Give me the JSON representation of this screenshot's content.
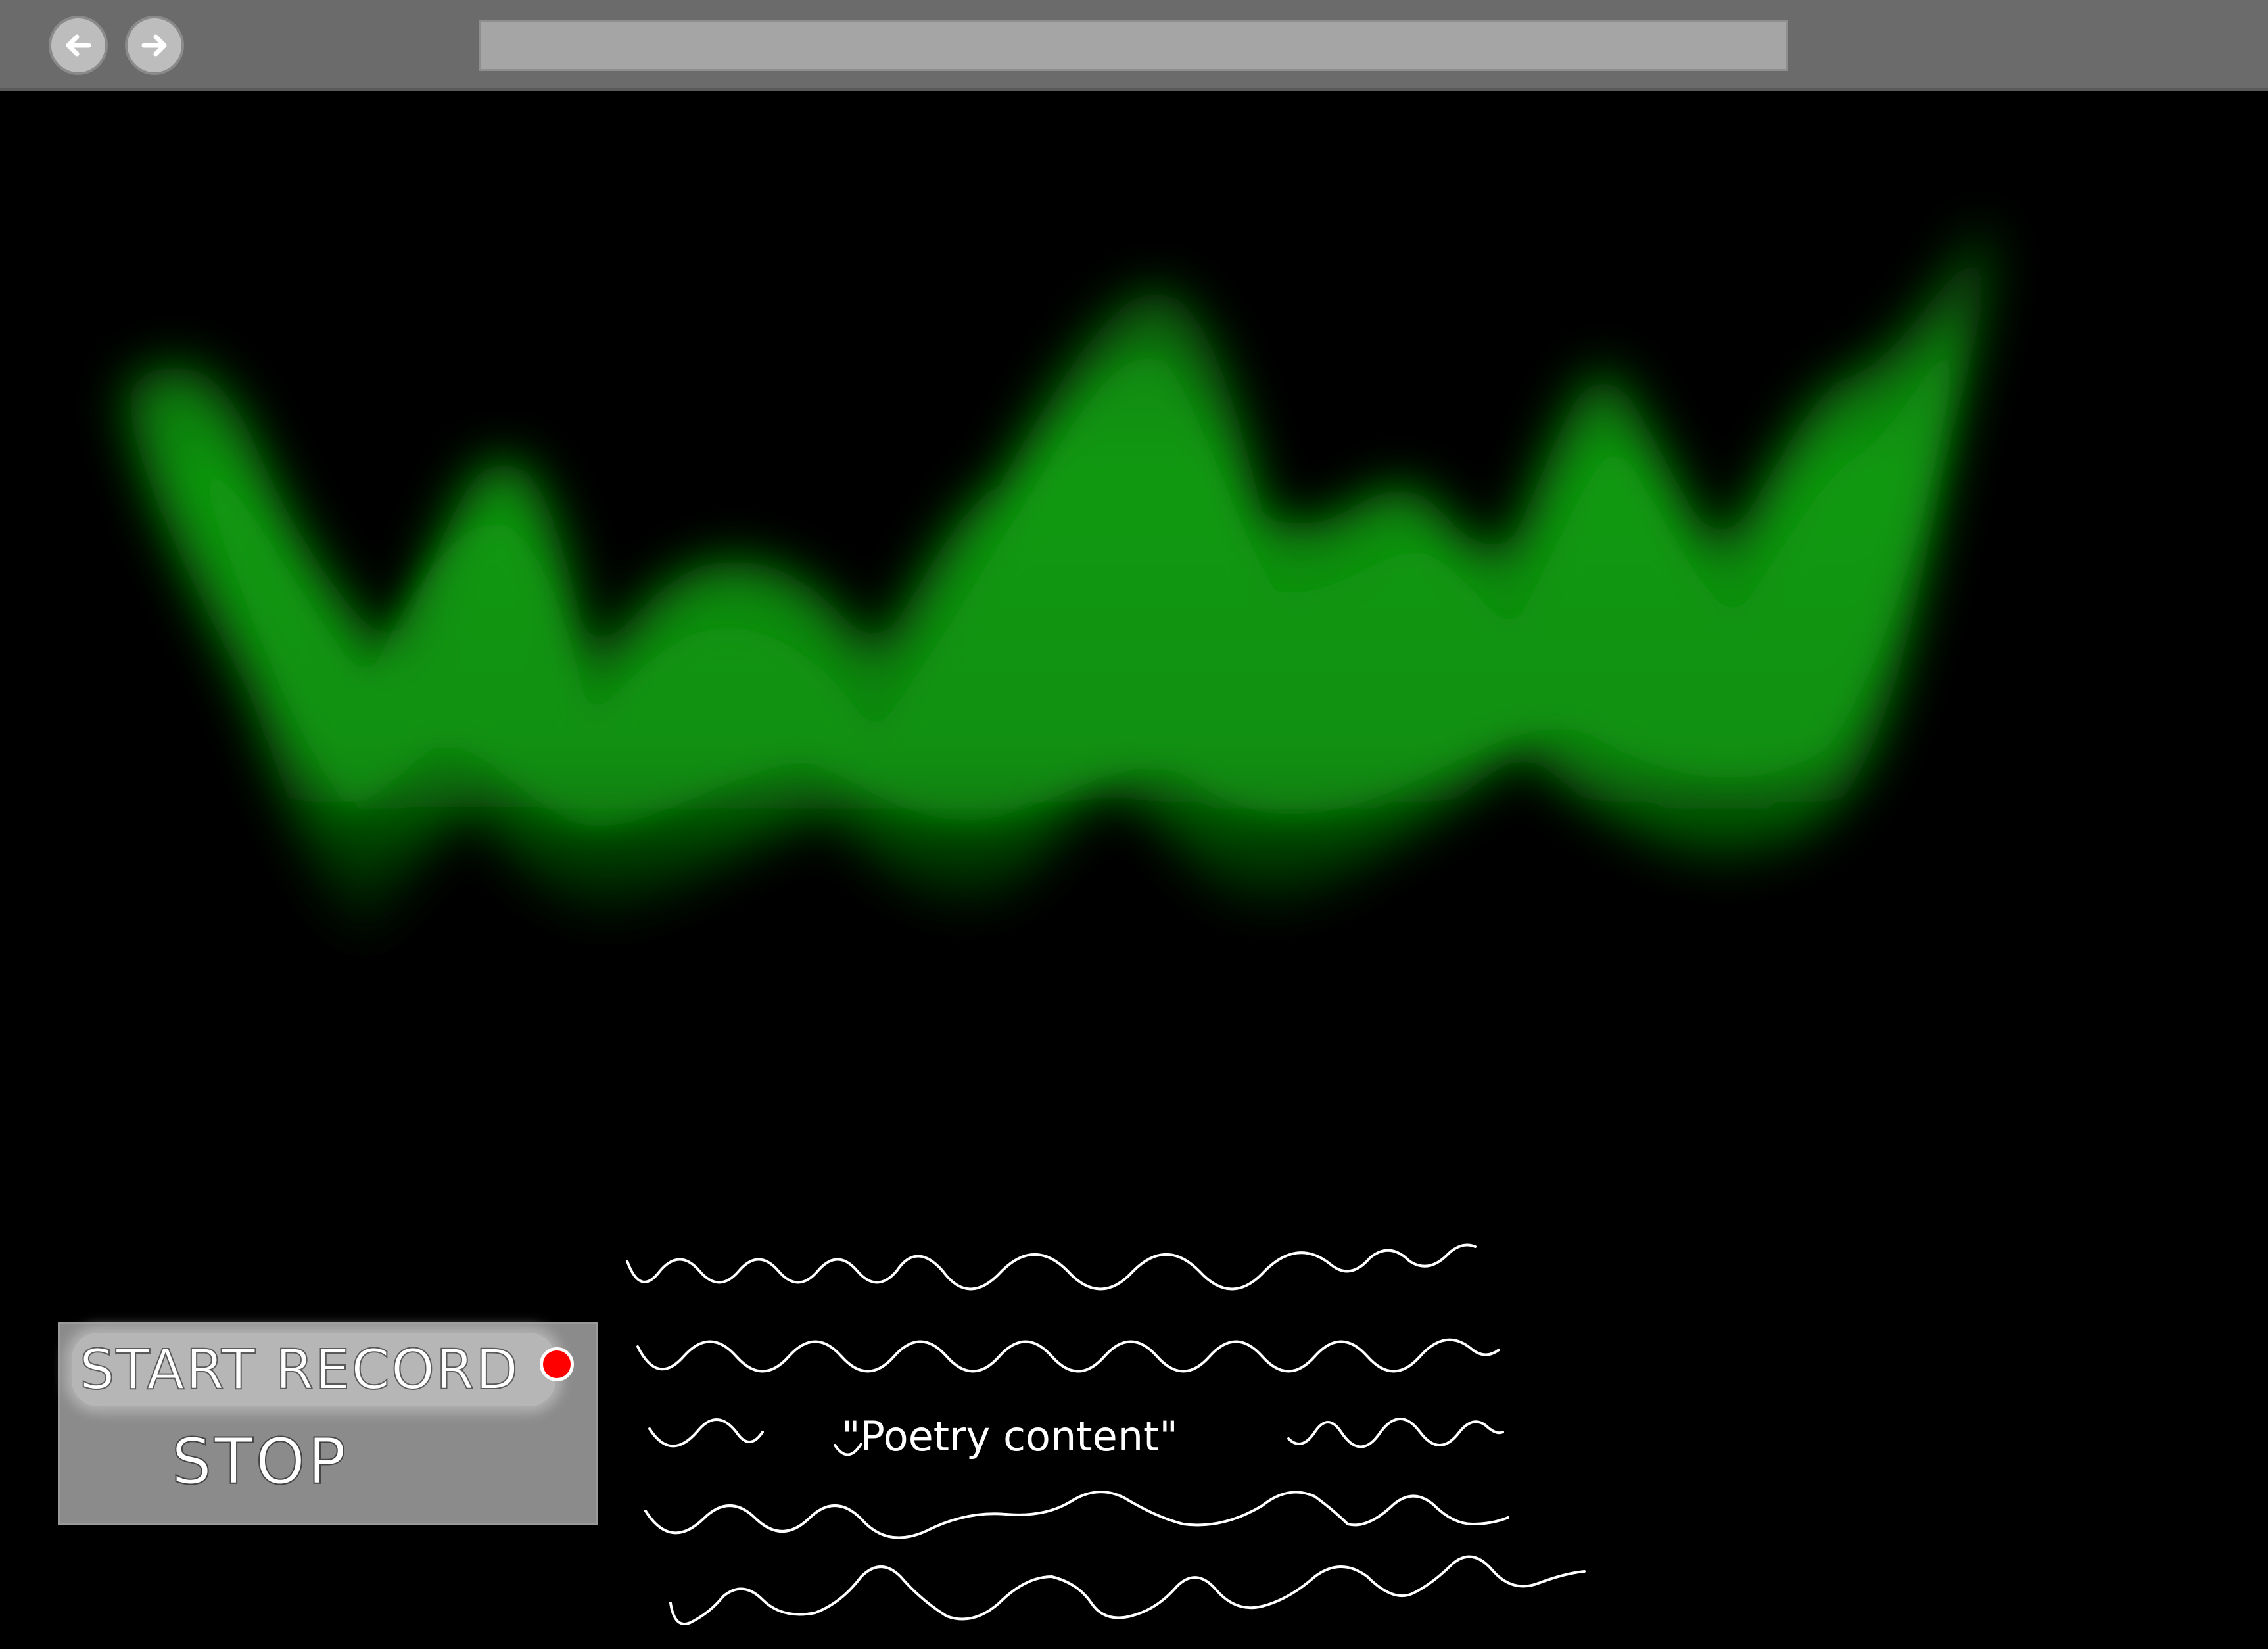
{
  "browser": {
    "back_icon": "arrow-left-icon",
    "forward_icon": "arrow-right-icon",
    "address_value": ""
  },
  "visualization": {
    "type": "audio-waveform",
    "color": "#0a9a0a"
  },
  "controls": {
    "start_record_label": "START RECORD",
    "record_indicator_color": "#ff0000",
    "stop_label": "STOP"
  },
  "poetry": {
    "content": "\"Poetry content\""
  }
}
